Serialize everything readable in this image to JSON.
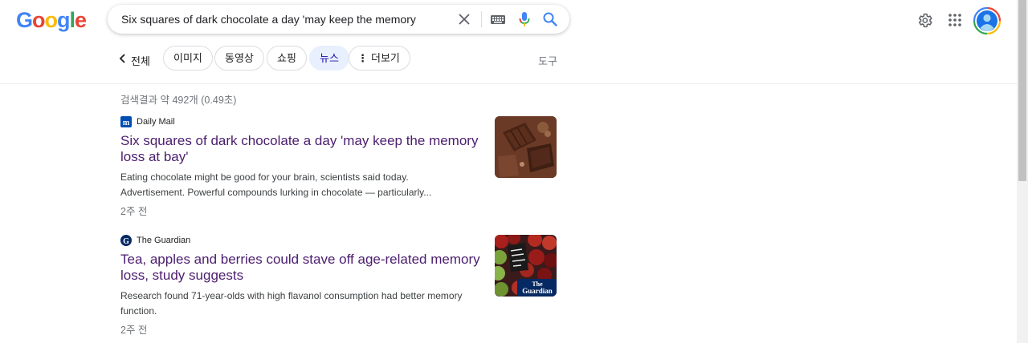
{
  "logo": {
    "letters": [
      "G",
      "o",
      "o",
      "g",
      "l",
      "e"
    ],
    "colors": [
      "#4285f4",
      "#ea4335",
      "#fbbc05",
      "#4285f4",
      "#34a853",
      "#ea4335"
    ]
  },
  "search": {
    "query": "Six squares of dark chocolate a day 'may keep the memory",
    "icons": [
      "clear-icon",
      "keyboard-icon",
      "mic-icon",
      "search-icon"
    ]
  },
  "header_icons": [
    "settings-gear-icon",
    "apps-grid-icon",
    "account-avatar"
  ],
  "tabs": {
    "all_label": "전체",
    "chips": [
      {
        "label": "이미지",
        "active": false
      },
      {
        "label": "동영상",
        "active": false
      },
      {
        "label": "쇼핑",
        "active": false
      },
      {
        "label": "뉴스",
        "active": true
      },
      {
        "label": "더보기",
        "active": false
      }
    ],
    "tools_label": "도구"
  },
  "stats": "검색결과 약 492개 (0.49초)",
  "results": [
    {
      "source": "Daily Mail",
      "title": "Six squares of dark chocolate a day 'may keep the memory loss at bay'",
      "snippet": "Eating chocolate might be good for your brain, scientists said today. Advertisement. Powerful compounds lurking in chocolate — particularly...",
      "time": "2주 전",
      "thumbnail": "chocolate-thumbnail"
    },
    {
      "source": "The Guardian",
      "title": "Tea, apples and berries could stave off age-related memory loss, study suggests",
      "snippet": "Research found 71-year-olds with high flavanol consumption had better memory function.",
      "time": "2주 전",
      "thumbnail": "apples-thumbnail",
      "thumbnail_brand": "The Guardian"
    }
  ],
  "colors": {
    "link_visited": "#4b1d6e",
    "active_chip_bg": "#e8f0fe",
    "muted_text": "#70757a"
  }
}
